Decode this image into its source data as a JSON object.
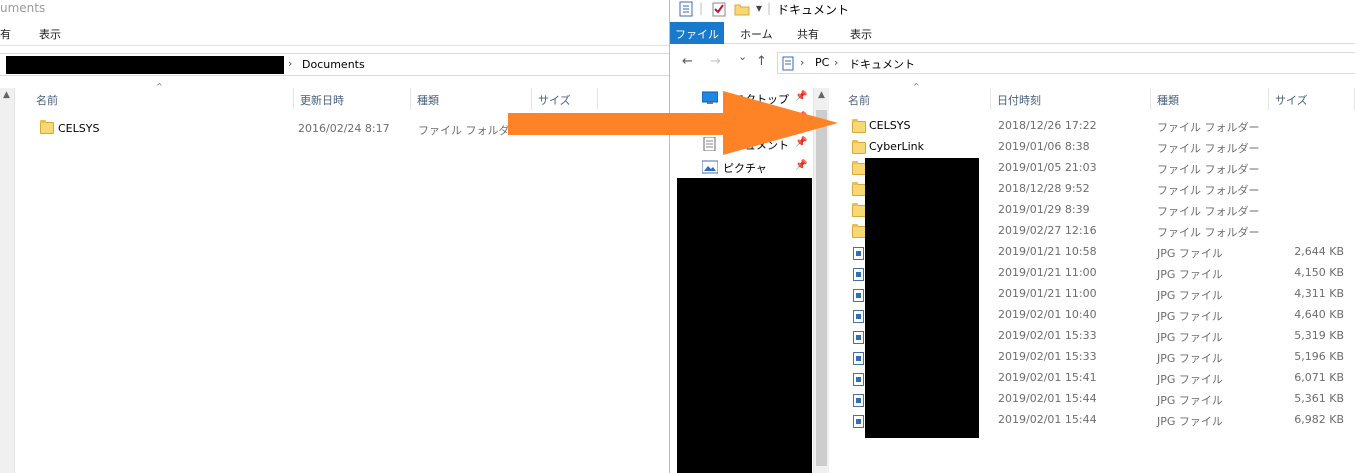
{
  "left_window": {
    "title_fragment": "uments",
    "ribbon_tabs": [
      "有",
      "表示"
    ],
    "address": {
      "separator": "›",
      "crumb": "Documents"
    },
    "columns": {
      "name": "名前",
      "modified": "更新日時",
      "type": "種類",
      "size": "サイズ"
    },
    "rows": [
      {
        "name": "CELSYS",
        "date": "2016/02/24 8:17",
        "type": "ファイル フォルダー",
        "icon": "folder-icon"
      }
    ]
  },
  "right_window": {
    "title": "ドキュメント",
    "quick_access": {
      "separator": "|",
      "dropdown": "▾"
    },
    "ribbon_tabs": {
      "file": "ファイル",
      "home": "ホーム",
      "share": "共有",
      "view": "表示"
    },
    "nav_buttons": {
      "back": "←",
      "forward": "→",
      "recent": "⌄",
      "up": "↑"
    },
    "address": {
      "sep1": "›",
      "pc": "PC",
      "sep2": "›",
      "documents": "ドキュメント"
    },
    "nav_pane": [
      {
        "label": "デスクトップ",
        "icon": "desktop-icon"
      },
      {
        "label": "",
        "icon": "download-icon"
      },
      {
        "label": "ドキュメント",
        "icon": "documents-icon"
      },
      {
        "label": "ピクチャ",
        "icon": "pictures-icon"
      }
    ],
    "pin_glyph": "📌",
    "columns": {
      "name": "名前",
      "date": "日付時刻",
      "type": "種類",
      "size": "サイズ"
    },
    "rows": [
      {
        "name": "CELSYS",
        "date": "2018/12/26 17:22",
        "type": "ファイル フォルダー",
        "size": "",
        "icon": "folder-icon"
      },
      {
        "name": "CyberLink",
        "date": "2019/01/06 8:38",
        "type": "ファイル フォルダー",
        "size": "",
        "icon": "folder-icon"
      },
      {
        "name": "",
        "date": "2019/01/05 21:03",
        "type": "ファイル フォルダー",
        "size": "",
        "icon": "folder-icon"
      },
      {
        "name": "",
        "date": "2018/12/28 9:52",
        "type": "ファイル フォルダー",
        "size": "",
        "icon": "folder-icon"
      },
      {
        "name": "",
        "date": "2019/01/29 8:39",
        "type": "ファイル フォルダー",
        "size": "",
        "icon": "folder-icon"
      },
      {
        "name": "",
        "date": "2019/02/27 12:16",
        "type": "ファイル フォルダー",
        "size": "",
        "icon": "folder-icon"
      },
      {
        "name": "",
        "date": "2019/01/21 10:58",
        "type": "JPG ファイル",
        "size": "2,644 KB",
        "icon": "jpg-file-icon"
      },
      {
        "name": "",
        "date": "2019/01/21 11:00",
        "type": "JPG ファイル",
        "size": "4,150 KB",
        "icon": "jpg-file-icon"
      },
      {
        "name": "",
        "date": "2019/01/21 11:00",
        "type": "JPG ファイル",
        "size": "4,311 KB",
        "icon": "jpg-file-icon"
      },
      {
        "name": "",
        "date": "2019/02/01 10:40",
        "type": "JPG ファイル",
        "size": "4,640 KB",
        "icon": "jpg-file-icon"
      },
      {
        "name": "",
        "date": "2019/02/01 15:33",
        "type": "JPG ファイル",
        "size": "5,319 KB",
        "icon": "jpg-file-icon"
      },
      {
        "name": "",
        "date": "2019/02/01 15:33",
        "type": "JPG ファイル",
        "size": "5,196 KB",
        "icon": "jpg-file-icon"
      },
      {
        "name": "",
        "date": "2019/02/01 15:41",
        "type": "JPG ファイル",
        "size": "6,071 KB",
        "icon": "jpg-file-icon"
      },
      {
        "name": "",
        "date": "2019/02/01 15:44",
        "type": "JPG ファイル",
        "size": "5,361 KB",
        "icon": "jpg-file-icon"
      },
      {
        "name": "",
        "date": "2019/02/01 15:44",
        "type": "JPG ファイル",
        "size": "6,982 KB",
        "icon": "jpg-file-icon"
      }
    ]
  },
  "colors": {
    "accent": "#1979ca",
    "arrow": "#fd8326",
    "header_text": "#4c607a",
    "redaction": "#000000"
  }
}
